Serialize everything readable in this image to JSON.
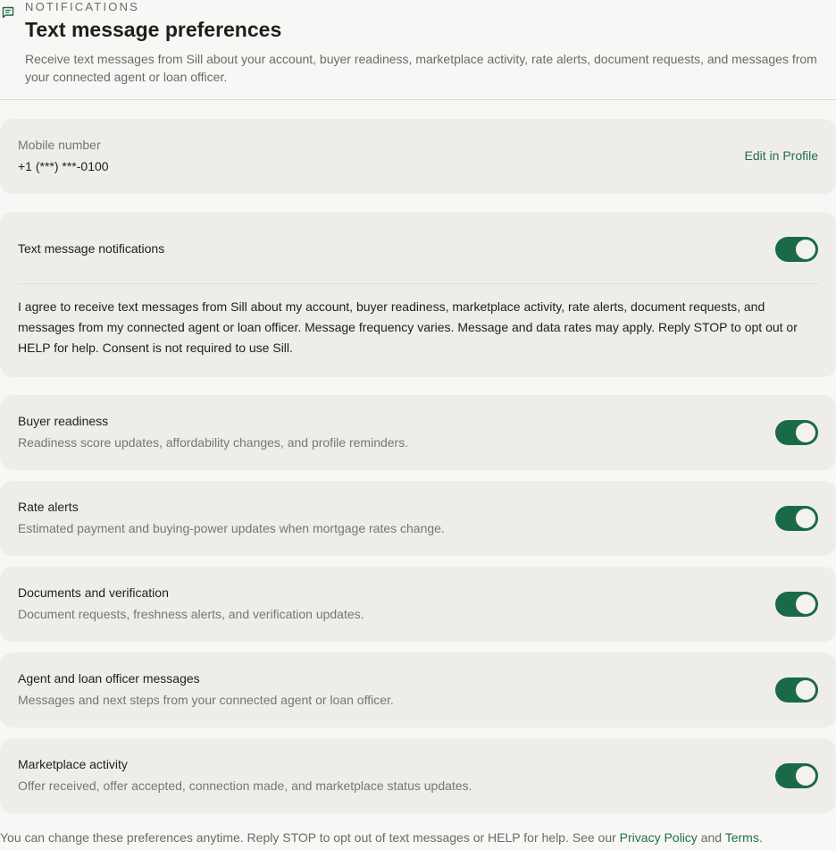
{
  "header": {
    "eyebrow": "NOTIFICATIONS",
    "title": "Text message preferences",
    "subtitle": "Receive text messages from Sill about your account, buyer readiness, marketplace activity, rate alerts, document requests, and messages from your connected agent or loan officer.",
    "icon": "message-icon"
  },
  "mobile": {
    "label": "Mobile number",
    "value": "+1 (***) ***-0100",
    "edit_link": "Edit in Profile"
  },
  "sms_master": {
    "label": "Text message notifications",
    "enabled": true,
    "consent": "I agree to receive text messages from Sill about my account, buyer readiness, marketplace activity, rate alerts, document requests, and messages from my connected agent or loan officer. Message frequency varies. Message and data rates may apply. Reply STOP to opt out or HELP for help. Consent is not required to use Sill."
  },
  "categories": [
    {
      "title": "Buyer readiness",
      "description": "Readiness score updates, affordability changes, and profile reminders.",
      "enabled": true
    },
    {
      "title": "Rate alerts",
      "description": "Estimated payment and buying-power updates when mortgage rates change.",
      "enabled": true
    },
    {
      "title": "Documents and verification",
      "description": "Document requests, freshness alerts, and verification updates.",
      "enabled": true
    },
    {
      "title": "Agent and loan officer messages",
      "description": "Messages and next steps from your connected agent or loan officer.",
      "enabled": true
    },
    {
      "title": "Marketplace activity",
      "description": "Offer received, offer accepted, connection made, and marketplace status updates.",
      "enabled": true
    }
  ],
  "footer": {
    "text": "You can change these preferences anytime. Reply STOP to opt out of text messages or HELP for help. See our",
    "privacy_link": "Privacy Policy",
    "and": "and",
    "terms_link": "Terms",
    "period": "."
  },
  "colors": {
    "accent": "#1b6a47",
    "card": "#efede9",
    "background": "#f8f7f5"
  }
}
